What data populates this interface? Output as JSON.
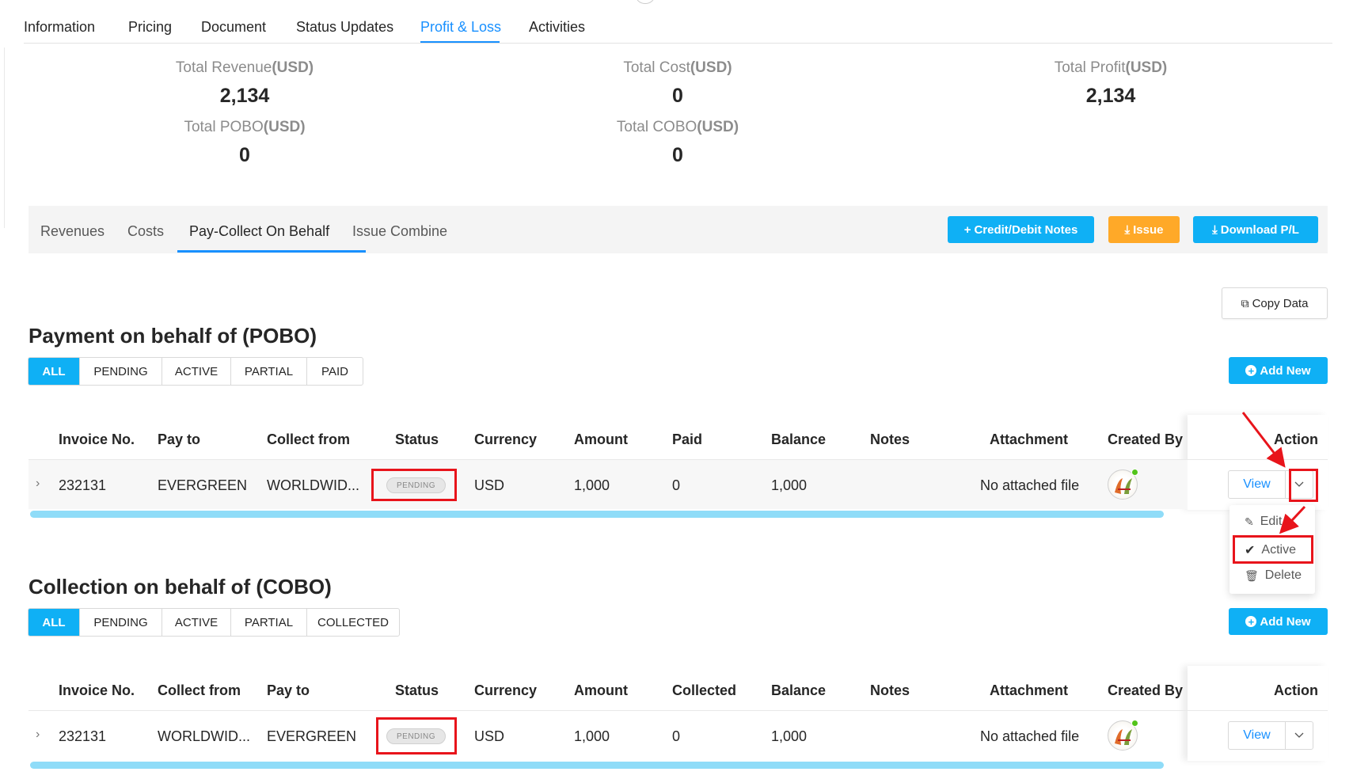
{
  "top_tabs": [
    "Information",
    "Pricing",
    "Document",
    "Status Updates",
    "Profit & Loss",
    "Activities"
  ],
  "active_top_tab": "Profit & Loss",
  "summary": {
    "total_revenue": {
      "label": "Total Revenue",
      "unit": "(USD)",
      "value": "2,134"
    },
    "total_cost": {
      "label": "Total Cost",
      "unit": "(USD)",
      "value": "0"
    },
    "total_profit": {
      "label": "Total Profit",
      "unit": "(USD)",
      "value": "2,134"
    },
    "total_pobo": {
      "label": "Total POBO",
      "unit": "(USD)",
      "value": "0"
    },
    "total_cobo": {
      "label": "Total COBO",
      "unit": "(USD)",
      "value": "0"
    }
  },
  "sub_tabs": [
    "Revenues",
    "Costs",
    "Pay-Collect On Behalf",
    "Issue Combine"
  ],
  "active_sub_tab": "Pay-Collect On Behalf",
  "actions": {
    "credit_debit": "Credit/Debit Notes",
    "issue": "Issue",
    "download": "Download P/L",
    "copy_data": "Copy Data",
    "add_new": "Add New"
  },
  "pobo": {
    "title": "Payment on behalf of (POBO)",
    "filters": [
      "ALL",
      "PENDING",
      "ACTIVE",
      "PARTIAL",
      "PAID"
    ],
    "columns": [
      "Invoice No.",
      "Pay to",
      "Collect from",
      "Status",
      "Currency",
      "Amount",
      "Paid",
      "Balance",
      "Notes",
      "Attachment",
      "Created By",
      "Action"
    ],
    "row": {
      "invoice_no": "232131",
      "pay_to": "EVERGREEN",
      "collect_from": "WORLDWID...",
      "status": "PENDING",
      "currency": "USD",
      "amount": "1,000",
      "paid": "0",
      "balance": "1,000",
      "notes": "",
      "attachment": "No attached file",
      "view": "View"
    }
  },
  "dropdown_menu": {
    "edit": "Edit",
    "active": "Active",
    "delete": "Delete"
  },
  "cobo": {
    "title": "Collection on behalf of (COBO)",
    "filters": [
      "ALL",
      "PENDING",
      "ACTIVE",
      "PARTIAL",
      "COLLECTED"
    ],
    "columns": [
      "Invoice No.",
      "Collect from",
      "Pay to",
      "Status",
      "Currency",
      "Amount",
      "Collected",
      "Balance",
      "Notes",
      "Attachment",
      "Created By",
      "Action"
    ],
    "row": {
      "invoice_no": "232131",
      "collect_from": "WORLDWID...",
      "pay_to": "EVERGREEN",
      "status": "PENDING",
      "currency": "USD",
      "amount": "1,000",
      "collected": "0",
      "balance": "1,000",
      "notes": "",
      "attachment": "No attached file",
      "view": "View"
    }
  },
  "colors": {
    "primary": "#1890ff",
    "button_blue": "#0fb0f5",
    "button_orange": "#ffa928",
    "annotation_red": "#e8141b"
  }
}
